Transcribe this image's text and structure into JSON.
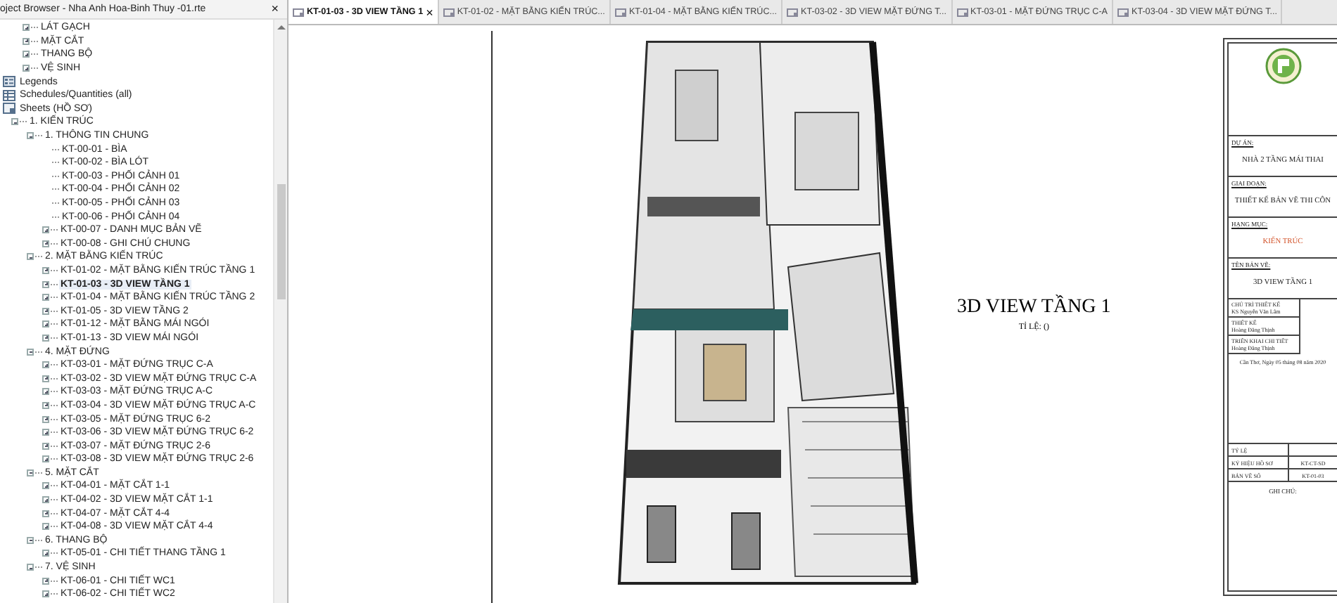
{
  "browser": {
    "title": "oject Browser - Nha Anh Hoa-Binh Thuy -01.rte",
    "close": "×",
    "scrolled_items": [
      {
        "label": "LÁT GẠCH",
        "expanded": false,
        "selected": false
      },
      {
        "label": "MẶT CẮT",
        "expanded": false,
        "selected": false
      },
      {
        "label": "THANG BỘ",
        "expanded": false,
        "selected": false
      },
      {
        "label": "VỆ SINH",
        "expanded": false,
        "selected": false
      }
    ],
    "tree": [
      {
        "label": "Legends",
        "kind": "legends",
        "selected": false
      },
      {
        "label": "Schedules/Quantities (all)",
        "kind": "schedules",
        "selected": false
      },
      {
        "label": "Sheets (HỒ SƠ)",
        "kind": "sheets",
        "selected": false,
        "children": [
          {
            "label": "1. KIẾN TRÚC",
            "expanded": true,
            "selected": false,
            "children": [
              {
                "label": "1. THÔNG TIN CHUNG",
                "expanded": true,
                "selected": false,
                "children": [
                  {
                    "label": "KT-00-01 - BÌA",
                    "selected": false
                  },
                  {
                    "label": "KT-00-02 - BÌA LÓT",
                    "selected": false
                  },
                  {
                    "label": "KT-00-03 - PHỐI CẢNH 01",
                    "selected": false
                  },
                  {
                    "label": "KT-00-04 - PHỐI CẢNH 02",
                    "selected": false
                  },
                  {
                    "label": "KT-00-05 - PHỐI CẢNH 03",
                    "selected": false
                  },
                  {
                    "label": "KT-00-06 - PHỐI CẢNH 04",
                    "selected": false
                  },
                  {
                    "label": "KT-00-07 - DANH MỤC BẢN VẼ",
                    "expanded": false,
                    "selected": false
                  },
                  {
                    "label": "KT-00-08 - GHI CHÚ CHUNG",
                    "expanded": false,
                    "selected": false
                  }
                ]
              },
              {
                "label": "2. MẶT BẰNG KIẾN TRÚC",
                "expanded": true,
                "selected": false,
                "children": [
                  {
                    "label": "KT-01-02 - MẶT BẰNG KIẾN TRÚC TẦNG 1",
                    "expanded": false,
                    "selected": false
                  },
                  {
                    "label": "KT-01-03 - 3D VIEW TẦNG 1",
                    "expanded": false,
                    "selected": true
                  },
                  {
                    "label": "KT-01-04 - MẶT BẰNG KIẾN TRÚC TẦNG 2",
                    "expanded": false,
                    "selected": false
                  },
                  {
                    "label": "KT-01-05 - 3D VIEW TẦNG 2",
                    "expanded": false,
                    "selected": false
                  },
                  {
                    "label": "KT-01-12 - MẶT BẰNG MÁI NGÓI",
                    "expanded": false,
                    "selected": false
                  },
                  {
                    "label": "KT-01-13 - 3D VIEW MÁI NGÓI",
                    "expanded": false,
                    "selected": false
                  }
                ]
              },
              {
                "label": "4. MẶT ĐỨNG",
                "expanded": true,
                "selected": false,
                "children": [
                  {
                    "label": "KT-03-01 - MẶT ĐỨNG TRỤC C-A",
                    "expanded": false,
                    "selected": false
                  },
                  {
                    "label": "KT-03-02 - 3D VIEW MẶT ĐỨNG TRỤC C-A",
                    "expanded": false,
                    "selected": false
                  },
                  {
                    "label": "KT-03-03 - MẶT ĐỨNG TRỤC A-C",
                    "expanded": false,
                    "selected": false
                  },
                  {
                    "label": "KT-03-04 - 3D VIEW MẶT ĐỨNG TRỤC A-C",
                    "expanded": false,
                    "selected": false
                  },
                  {
                    "label": "KT-03-05 - MẶT ĐỨNG TRỤC 6-2",
                    "expanded": false,
                    "selected": false
                  },
                  {
                    "label": "KT-03-06 - 3D VIEW MẶT ĐỨNG TRỤC 6-2",
                    "expanded": false,
                    "selected": false
                  },
                  {
                    "label": "KT-03-07 - MẶT ĐỨNG TRỤC 2-6",
                    "expanded": false,
                    "selected": false
                  },
                  {
                    "label": "KT-03-08 - 3D VIEW MẶT ĐỨNG TRỤC 2-6",
                    "expanded": false,
                    "selected": false
                  }
                ]
              },
              {
                "label": "5. MẶT CẮT",
                "expanded": true,
                "selected": false,
                "children": [
                  {
                    "label": "KT-04-01 - MẶT CẮT 1-1",
                    "expanded": false,
                    "selected": false
                  },
                  {
                    "label": "KT-04-02 - 3D VIEW MẶT CẮT 1-1",
                    "expanded": false,
                    "selected": false
                  },
                  {
                    "label": "KT-04-07 - MẶT CẮT 4-4",
                    "expanded": false,
                    "selected": false
                  },
                  {
                    "label": "KT-04-08 - 3D VIEW MẶT CẮT 4-4",
                    "expanded": false,
                    "selected": false
                  }
                ]
              },
              {
                "label": "6. THANG BỘ",
                "expanded": true,
                "selected": false,
                "children": [
                  {
                    "label": "KT-05-01 - CHI TIẾT THANG TẦNG 1",
                    "expanded": false,
                    "selected": false
                  }
                ]
              },
              {
                "label": "7. VỆ SINH",
                "expanded": true,
                "selected": false,
                "children": [
                  {
                    "label": "KT-06-01 - CHI TIẾT WC1",
                    "expanded": false,
                    "selected": false
                  },
                  {
                    "label": "KT-06-02 - CHI TIẾT WC2",
                    "expanded": false,
                    "selected": false
                  }
                ]
              }
            ]
          }
        ]
      }
    ]
  },
  "tabs": [
    {
      "label": "KT-01-03 - 3D VIEW TẦNG 1",
      "selected": true,
      "close": "×"
    },
    {
      "label": "KT-01-02 - MẶT BẰNG KIẾN TRÚC...",
      "selected": false
    },
    {
      "label": "KT-01-04 - MẶT BẰNG KIẾN TRÚC...",
      "selected": false
    },
    {
      "label": "KT-03-02 - 3D VIEW MẶT ĐỨNG T...",
      "selected": false
    },
    {
      "label": "KT-03-01 - MẶT ĐỨNG TRỤC C-A",
      "selected": false
    },
    {
      "label": "KT-03-04 - 3D VIEW MẶT ĐỨNG T...",
      "selected": false
    }
  ],
  "sheet": {
    "view_title": "3D VIEW TẦNG 1",
    "scale_label": "TỈ LỆ: ()",
    "title_block": {
      "sections": [
        {
          "label": "DỰ ÁN:",
          "value": "NHÀ  2 TẦNG MÁI THAI",
          "kind": "plain"
        },
        {
          "label": "GIAI ĐOẠN:",
          "value": "THIẾT KẾ BẢN VẼ THI CÔN",
          "kind": "plain"
        },
        {
          "label": "HẠNG MỤC:",
          "value": "KIẾN TRÚC",
          "kind": "accent"
        },
        {
          "label": "TÊN BẢN VẼ:",
          "value": "3D VIEW TẦNG 1",
          "kind": "plain"
        }
      ],
      "people": [
        {
          "role": "CHỦ TRÌ THIẾT KẾ",
          "name": "KS Nguyễn Văn Lâm"
        },
        {
          "role": "THIẾT KẾ",
          "name": "Hoàng Đăng Thịnh"
        },
        {
          "role": "TRIỂN KHAI CHI TIẾT",
          "name": "Hoàng Đăng Thịnh"
        }
      ],
      "date": "Cần Thơ, Ngày 05 tháng 08 năm 2020",
      "codes": [
        {
          "label": "TỶ LỆ"
        },
        {
          "label": "KÝ HIỆU HỒ SƠ",
          "value": "KT-CT-SD"
        },
        {
          "label": "BẢN VẼ SỐ",
          "value": "KT-01-03"
        }
      ],
      "notes_title": "GHI CHÚ:"
    }
  }
}
